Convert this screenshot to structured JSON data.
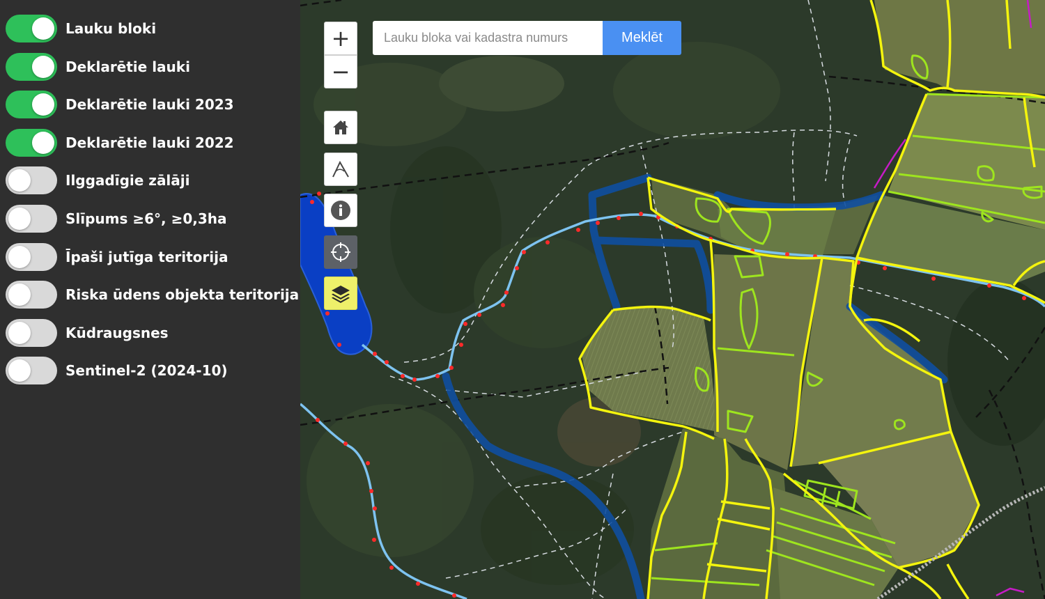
{
  "layers": [
    {
      "label": "Lauku bloki",
      "enabled": true
    },
    {
      "label": "Deklarētie lauki",
      "enabled": true
    },
    {
      "label": "Deklarētie lauki 2023",
      "enabled": true
    },
    {
      "label": "Deklarētie lauki 2022",
      "enabled": true
    },
    {
      "label": "Ilggadīgie zālāji",
      "enabled": false
    },
    {
      "label": "Slīpums ≥6°, ≥0,3ha",
      "enabled": false
    },
    {
      "label": "Īpaši jutīga teritorija",
      "enabled": false
    },
    {
      "label": "Riska ūdens objekta teritorija",
      "enabled": false
    },
    {
      "label": "Kūdraugsnes",
      "enabled": false
    },
    {
      "label": "Sentinel-2 (2024-10)",
      "enabled": false
    }
  ],
  "search": {
    "placeholder": "Lauku bloka vai kadastra numurs",
    "button_label": "Meklēt"
  },
  "controls": {
    "zoom_in": "+",
    "zoom_out": "−"
  },
  "colors": {
    "toggle_on": "#2ec05a",
    "toggle_off": "#d9d9d9",
    "search_button": "#4a90f2",
    "field_block_outline": "#f4f40e",
    "declared_field_outline": "#9ee51e",
    "water": "#0a3fc4",
    "stream": "#7ec3f0",
    "stream_point": "#ff2a2a",
    "active_control": "#eef06a"
  }
}
